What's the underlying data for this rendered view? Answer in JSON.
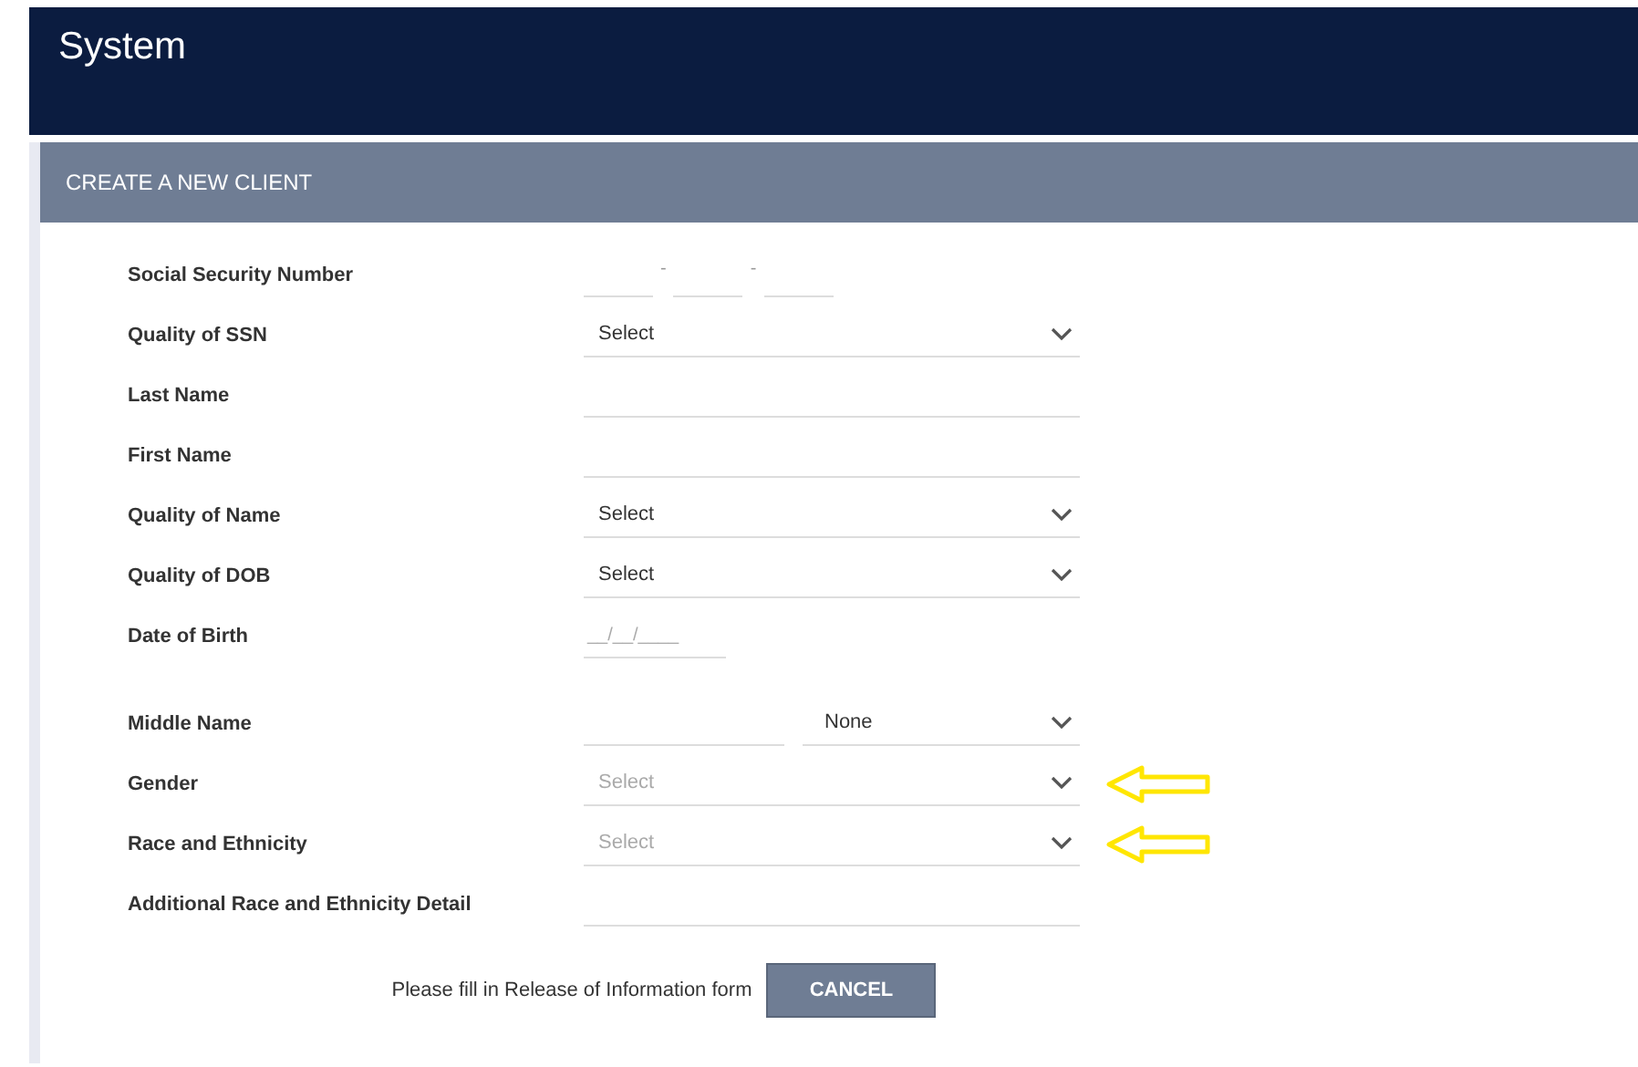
{
  "app_bar": {
    "title": "System"
  },
  "panel": {
    "title": "CREATE A NEW CLIENT"
  },
  "fields": [
    {
      "kind": "ssn",
      "label": "Social Security Number",
      "separators": [
        "-",
        "-"
      ],
      "marked": false
    },
    {
      "kind": "select",
      "label": "Quality of SSN",
      "value": "Select",
      "marked": false
    },
    {
      "kind": "text",
      "label": "Last Name",
      "marked": false
    },
    {
      "kind": "text",
      "label": "First Name",
      "marked": false
    },
    {
      "kind": "select",
      "label": "Quality of Name",
      "value": "Select",
      "marked": false
    },
    {
      "kind": "select",
      "label": "Quality of DOB",
      "value": "Select",
      "marked": false
    },
    {
      "kind": "date",
      "label": "Date of Birth",
      "placeholder": "__/__/____",
      "marked": false
    },
    {
      "kind": "middle",
      "label": "Middle Name",
      "suffix": "None",
      "marked": false
    },
    {
      "kind": "select",
      "label": "Gender",
      "placeholder": "Select",
      "marked": true
    },
    {
      "kind": "select",
      "label": "Race and Ethnicity",
      "placeholder": "Select",
      "marked": true
    },
    {
      "kind": "text",
      "label": "Additional Race and Ethnicity Detail",
      "marked": false
    }
  ],
  "footer": {
    "message": "Please fill in Release of Information form",
    "button": "CANCEL"
  }
}
